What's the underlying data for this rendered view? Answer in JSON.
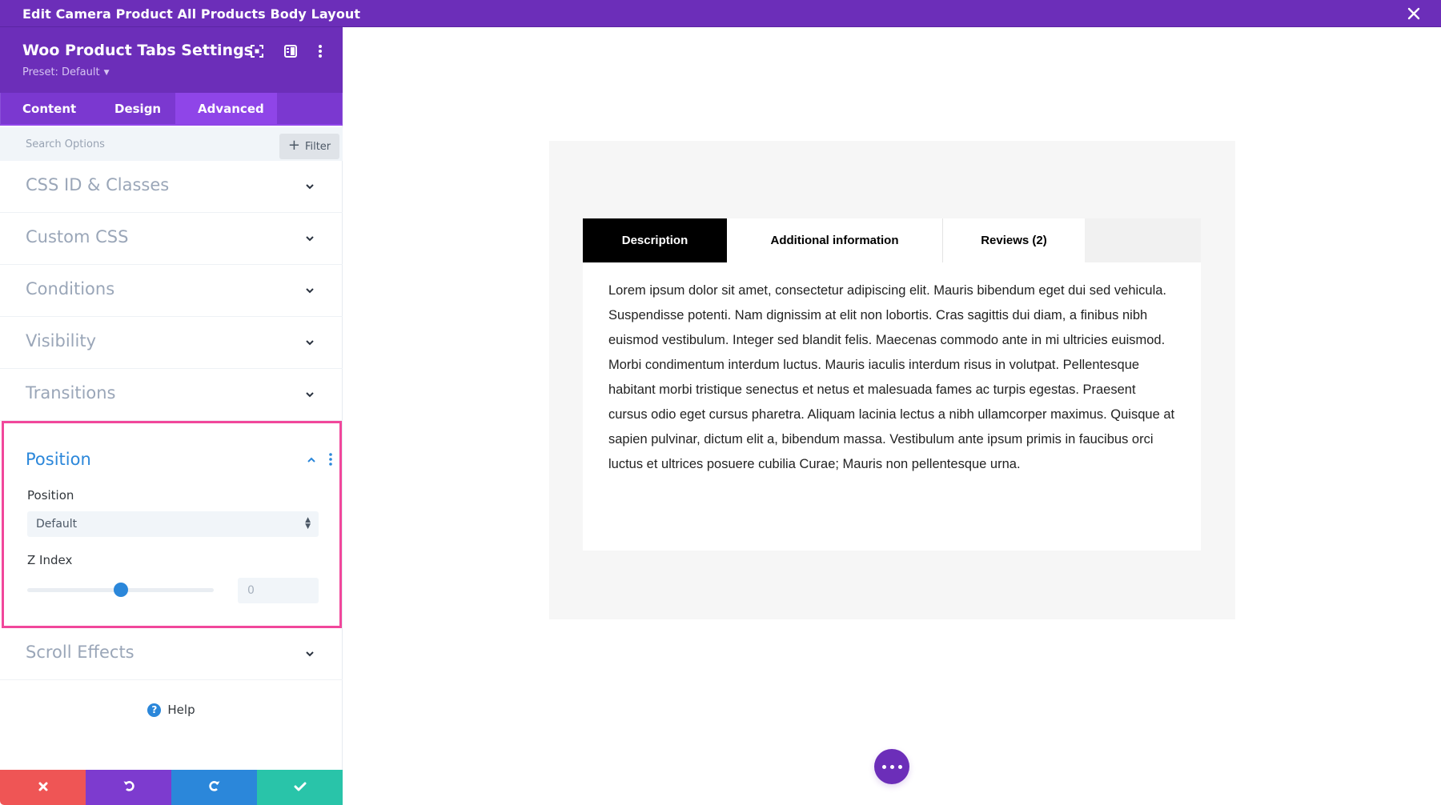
{
  "topbar": {
    "title": "Edit Camera Product All Products Body Layout",
    "close_icon": "close-icon"
  },
  "sidebar": {
    "module_title": "Woo Product Tabs Settings",
    "preset_label": "Preset: Default",
    "header_icons": [
      "focus-mode-icon",
      "split-view-icon",
      "more-options-icon"
    ],
    "tabs": [
      {
        "label": "Content",
        "active": false
      },
      {
        "label": "Design",
        "active": false
      },
      {
        "label": "Advanced",
        "active": true
      }
    ],
    "search": {
      "placeholder": "Search Options",
      "value": ""
    },
    "filter_label": "Filter",
    "sections": [
      {
        "label": "CSS ID & Classes",
        "expanded": false
      },
      {
        "label": "Custom CSS",
        "expanded": false
      },
      {
        "label": "Conditions",
        "expanded": false
      },
      {
        "label": "Visibility",
        "expanded": false
      },
      {
        "label": "Transitions",
        "expanded": false
      },
      {
        "label": "Position",
        "expanded": true
      },
      {
        "label": "Scroll Effects",
        "expanded": false
      }
    ],
    "position_section": {
      "title": "Position",
      "position_field_label": "Position",
      "position_value": "Default",
      "z_index_label": "Z Index",
      "z_index_value": "0",
      "z_index_slider_fraction": 0.5,
      "highlight_color": "#f1479b"
    },
    "help_label": "Help",
    "footer": {
      "buttons": [
        {
          "name": "discard",
          "icon": "close-icon",
          "color": "#ef5555"
        },
        {
          "name": "undo",
          "icon": "undo-icon",
          "color": "#7d3bcf"
        },
        {
          "name": "redo",
          "icon": "redo-icon",
          "color": "#2b87da"
        },
        {
          "name": "save",
          "icon": "check-icon",
          "color": "#29c4a9"
        }
      ]
    }
  },
  "canvas": {
    "product_tabs": [
      {
        "label": "Description",
        "active": true
      },
      {
        "label": "Additional information",
        "active": false
      },
      {
        "label": "Reviews (2)",
        "active": false
      }
    ],
    "description_text": "Lorem ipsum dolor sit amet, consectetur adipiscing elit. Mauris bibendum eget dui sed vehicula. Suspendisse potenti. Nam dignissim at elit non lobortis. Cras sagittis dui diam, a finibus nibh euismod vestibulum. Integer sed blandit felis. Maecenas commodo ante in mi ultricies euismod. Morbi condimentum interdum luctus. Mauris iaculis interdum risus in volutpat. Pellentesque habitant morbi tristique senectus et netus et malesuada fames ac turpis egestas. Praesent cursus odio eget cursus pharetra. Aliquam lacinia lectus a nibh ullamcorper maximus. Quisque at sapien pulvinar, dictum elit a, bibendum massa. Vestibulum ante ipsum primis in faucibus orci luctus et ultrices posuere cubilia Curae; Mauris non pellentesque urna.",
    "fab_icon": "more-dots-icon"
  },
  "colors": {
    "brand_purple": "#6c2eb9",
    "tab_active": "#8f45e8",
    "accent_blue": "#2b87da"
  }
}
